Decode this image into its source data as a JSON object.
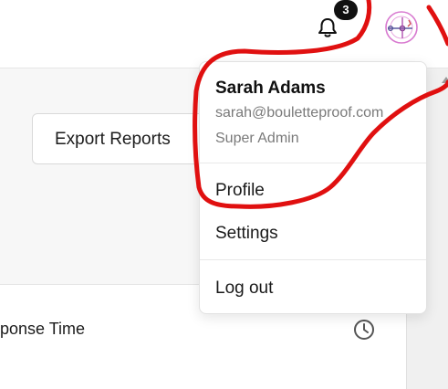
{
  "header": {
    "notification_count": "3",
    "bell_icon": "bell-icon",
    "avatar_icon": "user-avatar-icon"
  },
  "main": {
    "export_button_label": "Export Reports",
    "card_title": "ponse Time",
    "clock_icon": "clock-icon"
  },
  "user_menu": {
    "name": "Sarah Adams",
    "email": "sarah@bouletteproof.com",
    "role": "Super Admin",
    "items": [
      {
        "label": "Profile"
      },
      {
        "label": "Settings"
      },
      {
        "label": "Log out"
      }
    ]
  },
  "colors": {
    "annotation_red": "#e01010",
    "badge_bg": "#111111",
    "avatar_ring": "#d87ad0"
  }
}
